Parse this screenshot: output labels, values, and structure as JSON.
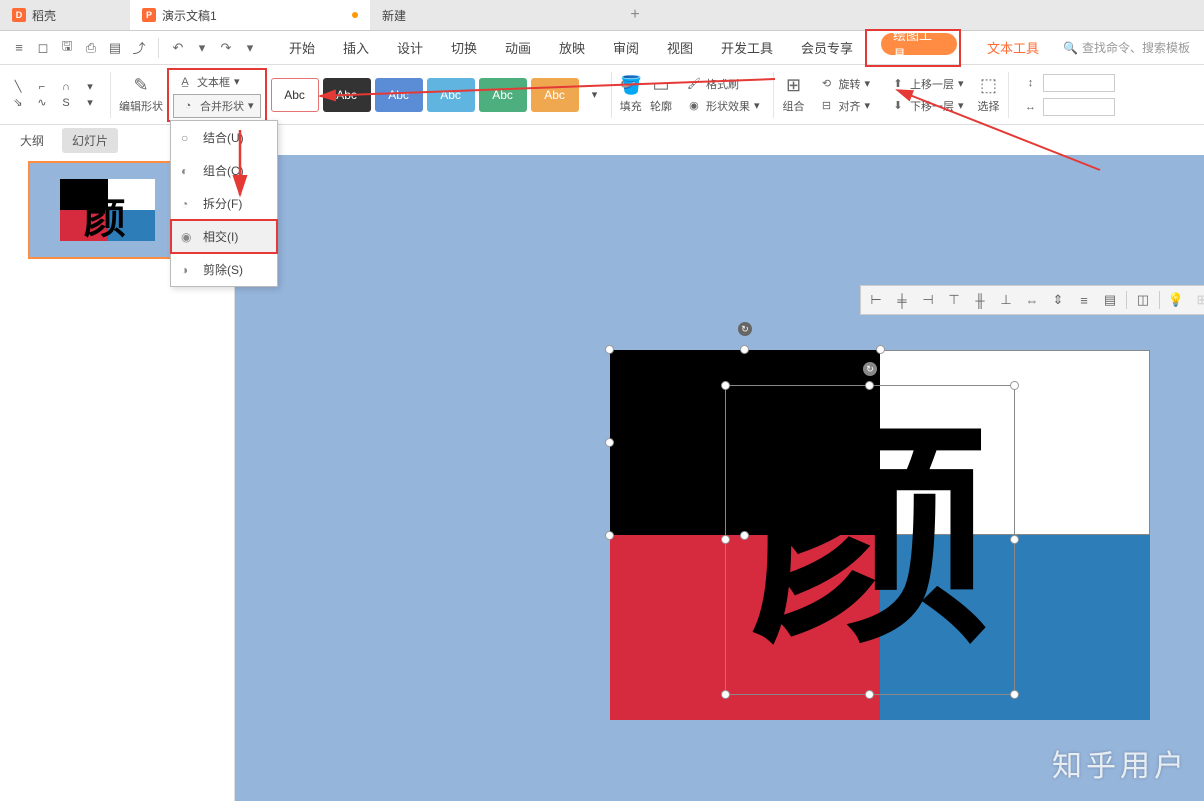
{
  "tabs": {
    "docer": "稻壳",
    "presentation": "演示文稿1",
    "new": "新建",
    "plus": "+"
  },
  "qat": {
    "undo": "↶",
    "redo": "↷"
  },
  "menu": {
    "start": "开始",
    "insert": "插入",
    "design": "设计",
    "transition": "切换",
    "animation": "动画",
    "slideshow": "放映",
    "review": "审阅",
    "view": "视图",
    "devtools": "开发工具",
    "member": "会员专享",
    "drawing": "绘图工具",
    "texttools": "文本工具"
  },
  "search": {
    "placeholder": "查找命令、搜索模板"
  },
  "ribbon": {
    "edit_shape": "编辑形状",
    "textbox": "文本框",
    "merge_shapes": "合并形状",
    "abc": "Abc",
    "fill": "填充",
    "outline": "轮廓",
    "effect": "形状效果",
    "format_painter": "格式刷",
    "group": "组合",
    "align": "对齐",
    "rotate": "旋转",
    "bring_forward": "上移一层",
    "send_backward": "下移一层",
    "select": "选择"
  },
  "dropdown": {
    "union": "结合(U)",
    "combine": "组合(C)",
    "fragment": "拆分(F)",
    "intersect": "相交(I)",
    "subtract": "剪除(S)"
  },
  "view_tabs": {
    "outline": "大纲",
    "slides": "幻灯片"
  },
  "canvas": {
    "character": "颜"
  },
  "watermark": "知乎用户"
}
